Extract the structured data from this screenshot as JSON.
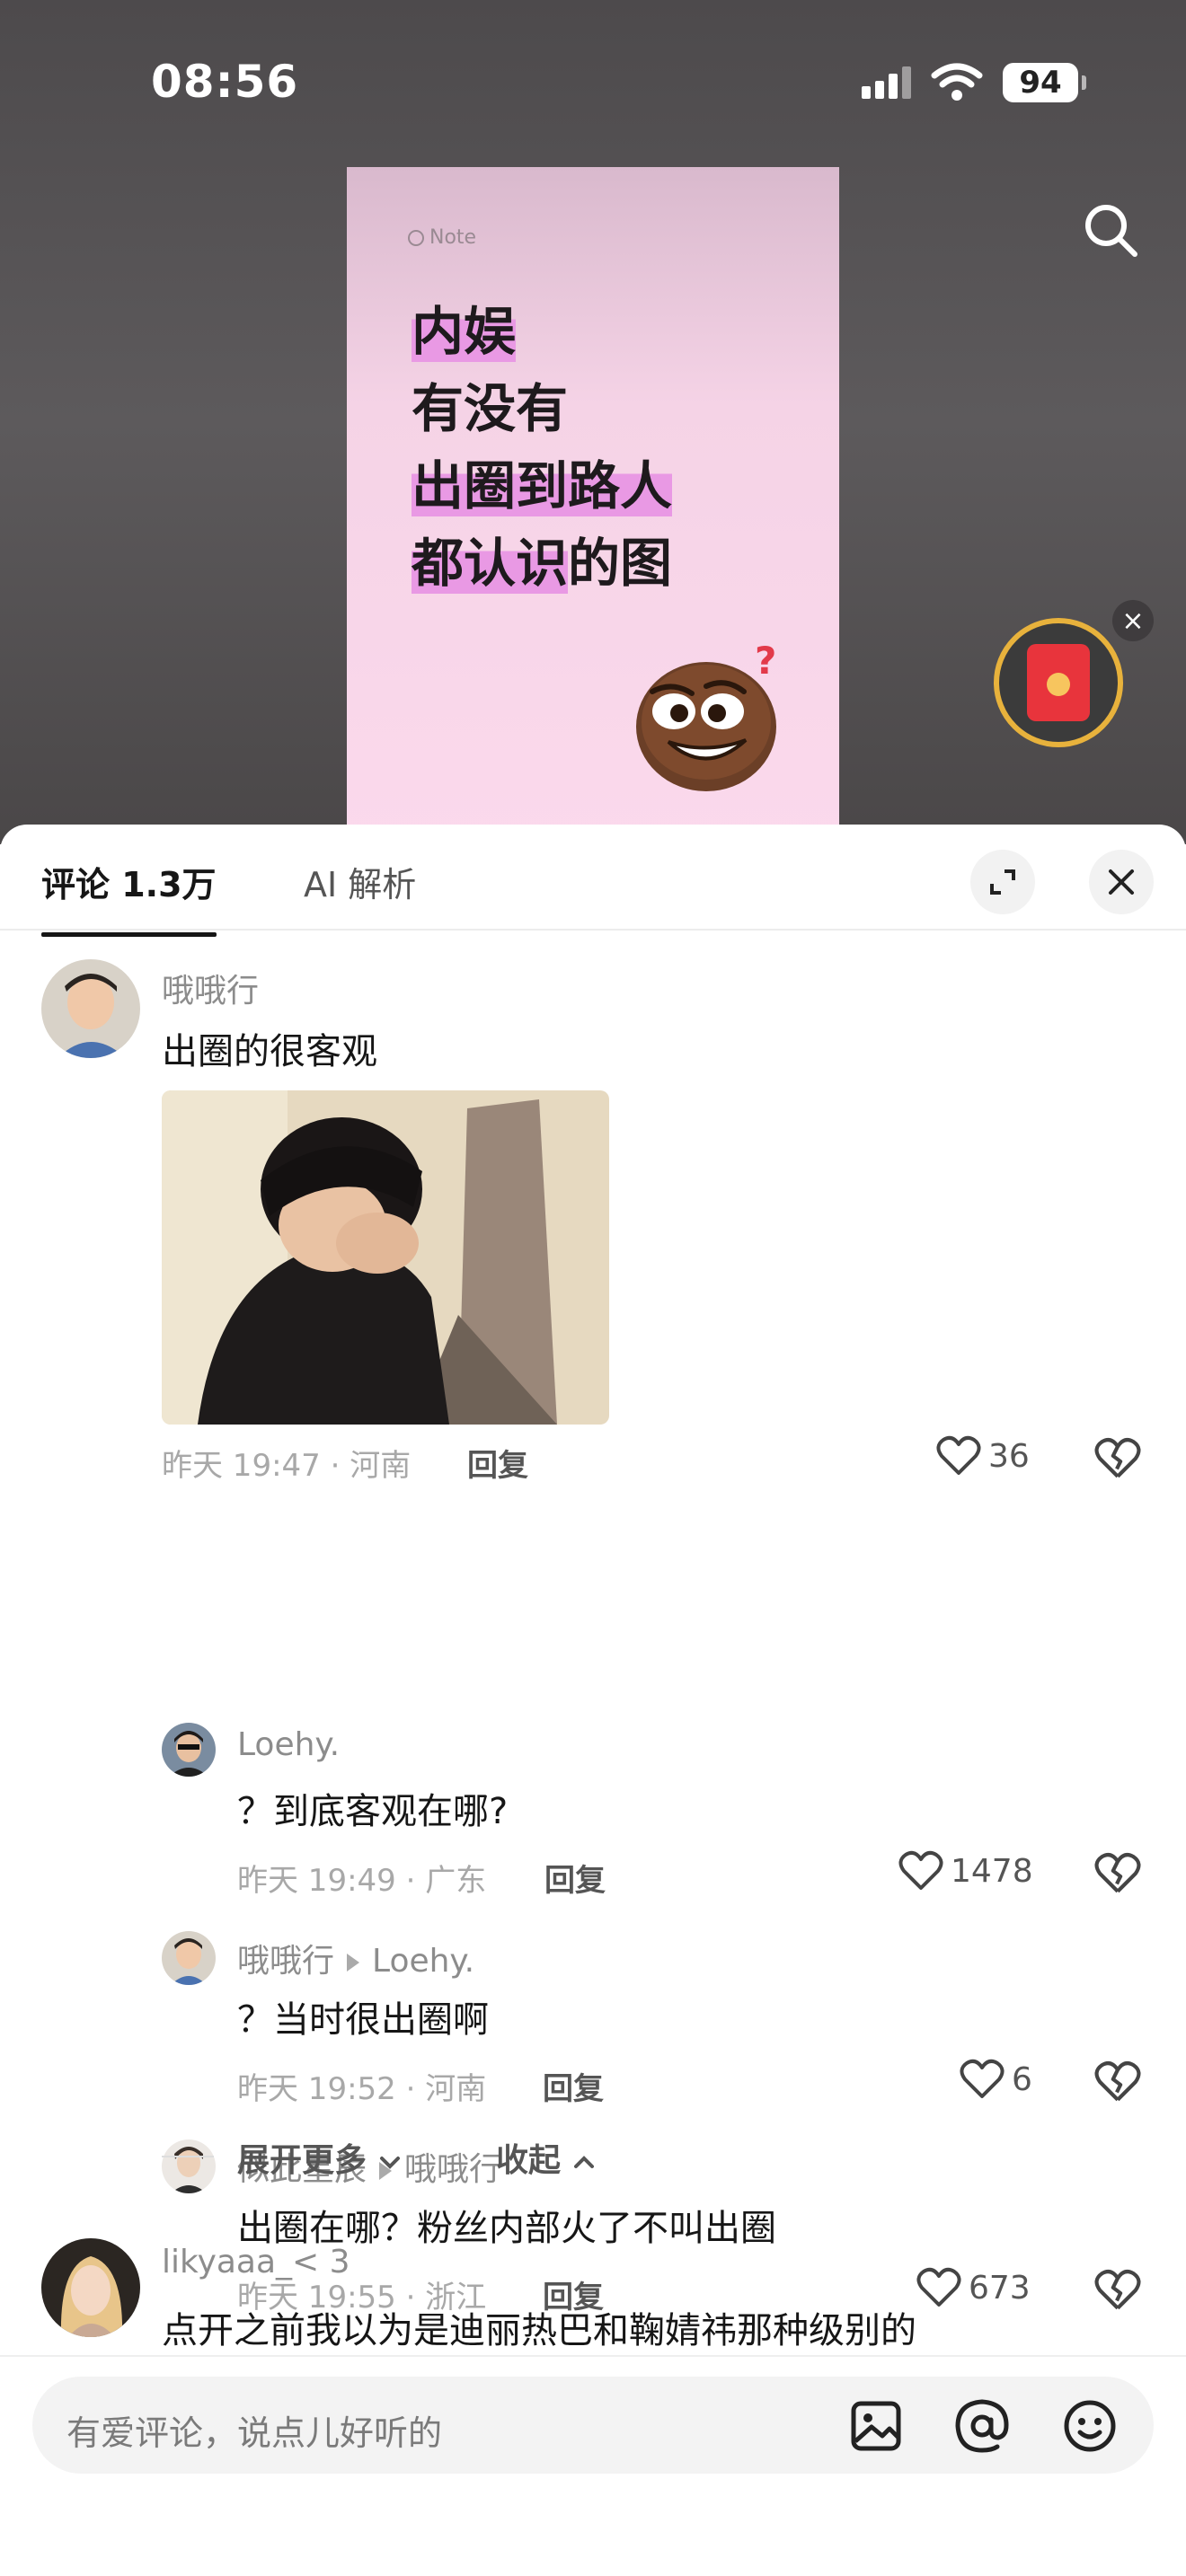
{
  "status_bar": {
    "time": "08:56",
    "battery": "94"
  },
  "poster": {
    "note_label": "Note",
    "lines": [
      [
        {
          "t": "内娱",
          "h": true
        }
      ],
      [
        {
          "t": "有没有",
          "h": false
        }
      ],
      [
        {
          "t": "出圈到路人",
          "h": true
        }
      ],
      [
        {
          "t": "都认识",
          "h": true
        },
        {
          "t": "的图",
          "h": false
        }
      ]
    ]
  },
  "sheet": {
    "tabs": {
      "comments": "评论 1.3万",
      "ai": "AI 解析"
    }
  },
  "comments": {
    "c1": {
      "user": "哦哦行",
      "text": "出圈的很客观",
      "meta": "昨天 19:47 · 河南",
      "reply": "回复",
      "likes": "36"
    },
    "r1": {
      "user": "Loehy.",
      "text": "？到底客观在哪?",
      "meta": "昨天 19:49 · 广东",
      "reply": "回复",
      "likes": "1478"
    },
    "r2": {
      "user": "哦哦行",
      "to": "Loehy.",
      "text": "？当时很出圈啊",
      "meta": "昨天 19:52 · 河南",
      "reply": "回复",
      "likes": "6"
    },
    "r3": {
      "user": "似此星辰",
      "to": "哦哦行",
      "text": "出圈在哪？粉丝内部火了不叫出圈",
      "meta": "昨天 19:55 · 浙江",
      "reply": "回复",
      "likes": "673"
    },
    "expand_more": "展开更多",
    "collapse": "收起",
    "c2": {
      "user": "likyaaa_< 3",
      "text": "点开之前我以为是迪丽热巴和鞠婧祎那种级别的"
    }
  },
  "input": {
    "placeholder": "有爱评论，说点儿好听的"
  }
}
